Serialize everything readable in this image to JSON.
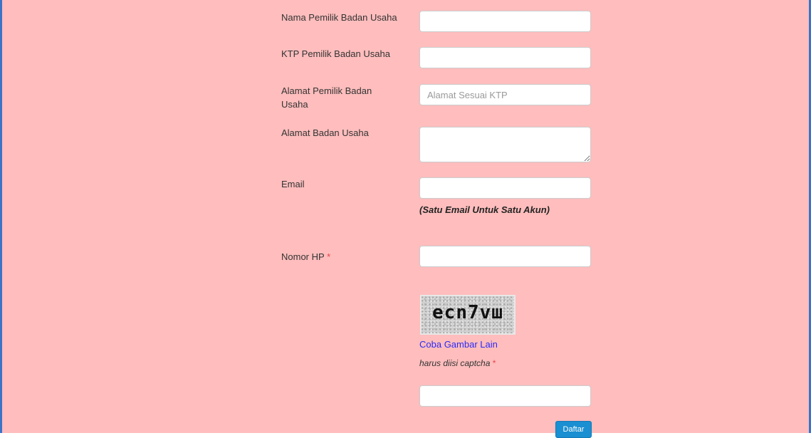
{
  "form": {
    "fields": [
      {
        "label": "Nama Pemilik Badan Usaha",
        "value": "",
        "placeholder": ""
      },
      {
        "label": "KTP Pemilik Badan Usaha",
        "value": "",
        "placeholder": ""
      },
      {
        "label": "Alamat Pemilik Badan Usaha",
        "value": "",
        "placeholder": "Alamat Sesuai KTP"
      },
      {
        "label": "Alamat Badan Usaha",
        "value": "",
        "placeholder": ""
      },
      {
        "label": "Email",
        "value": "",
        "placeholder": ""
      },
      {
        "label": "Nomor HP",
        "required_mark": "*",
        "value": "",
        "placeholder": ""
      }
    ],
    "email_hint": "(Satu Email Untuk Satu Akun)",
    "captcha": {
      "image_text": "ecn7vш",
      "refresh_link": "Coba Gambar Lain",
      "note": "harus diisi captcha",
      "required_mark": "*",
      "value": ""
    },
    "submit_label": "Daftar"
  },
  "colors": {
    "background": "#ffbdbd",
    "frame_border": "#3a73c8",
    "required": "#e8444a",
    "link": "#2a2af5",
    "button": "#1a8fd1"
  }
}
